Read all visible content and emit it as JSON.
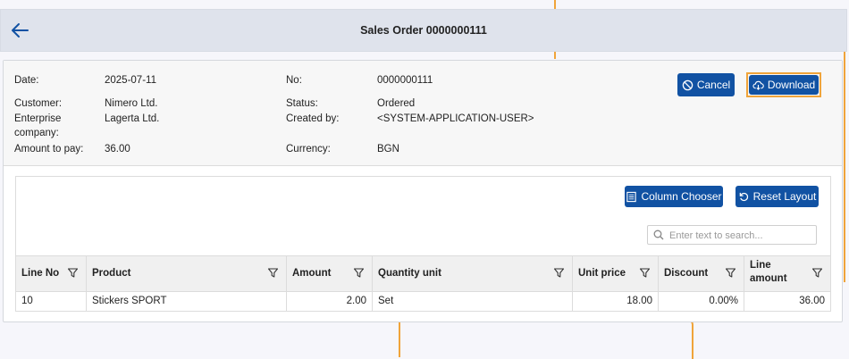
{
  "header": {
    "title": "Sales Order 0000000111",
    "back_icon": "arrow-left-icon"
  },
  "order": {
    "date_label": "Date:",
    "date_value": "2025-07-11",
    "no_label": "No:",
    "no_value": "0000000111",
    "customer_label": "Customer:",
    "customer_value": "Nimero Ltd.",
    "status_label": "Status:",
    "status_value": "Ordered",
    "enterprise_label_1": "Enterprise",
    "enterprise_label_2": "company:",
    "enterprise_value": "Lagerta Ltd.",
    "created_by_label": "Created by:",
    "created_by_value": "<SYSTEM-APPLICATION-USER>",
    "amount_label": "Amount to pay:",
    "amount_value": "36.00",
    "currency_label": "Currency:",
    "currency_value": "BGN"
  },
  "actions": {
    "cancel_label": "Cancel",
    "download_label": "Download"
  },
  "grid": {
    "column_chooser_label": "Column Chooser",
    "reset_layout_label": "Reset Layout",
    "search_placeholder": "Enter text to search...",
    "columns": [
      {
        "label": "Line No"
      },
      {
        "label": "Product"
      },
      {
        "label": "Amount"
      },
      {
        "label": "Quantity unit"
      },
      {
        "label": "Unit price"
      },
      {
        "label": "Discount"
      },
      {
        "label_1": "Line",
        "label_2": "amount"
      }
    ],
    "rows": [
      [
        "10",
        "Stickers SPORT",
        "2.00",
        "Set",
        "18.00",
        "0.00%",
        "36.00"
      ]
    ]
  },
  "colors": {
    "primary": "#1152a3",
    "highlight": "#f0a43a",
    "header_bg": "#dfe3ec"
  }
}
